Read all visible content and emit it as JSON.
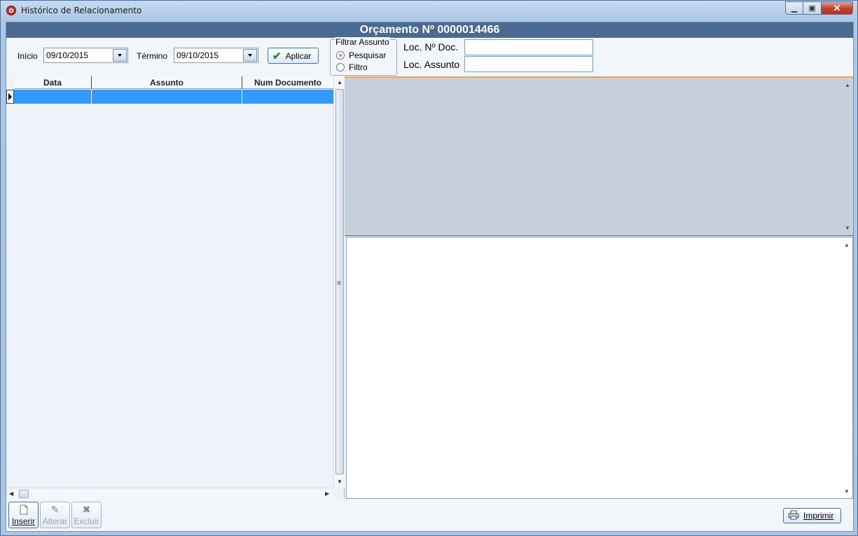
{
  "window": {
    "title": "Histórico de Relacionamento"
  },
  "banner": {
    "title": "Orçamento Nº 0000014466"
  },
  "filters": {
    "inicio_label": "Início",
    "inicio_value": "09/10/2015",
    "termino_label": "Término",
    "termino_value": "09/10/2015",
    "aplicar_label": "Aplicar",
    "group_title": "Filtrar Assunto",
    "radio_pesquisar": "Pesquisar",
    "radio_filtro": "Filtro",
    "loc_doc_label": "Loc. Nº Doc.",
    "loc_assunto_label": "Loc. Assunto"
  },
  "grid": {
    "columns": [
      "Data",
      "Assunto",
      "Num Documento"
    ]
  },
  "toolbar": {
    "inserir": "Inserir",
    "alterar": "Alterar",
    "excluir": "Excluir",
    "imprimir": "Imprimir"
  },
  "icons": [
    "app-icon",
    "minimize-icon",
    "maximize-icon",
    "close-icon",
    "calendar-dropdown-icon",
    "checkmark-icon",
    "new-document-icon",
    "edit-pencil-icon",
    "delete-x-icon",
    "printer-icon"
  ]
}
